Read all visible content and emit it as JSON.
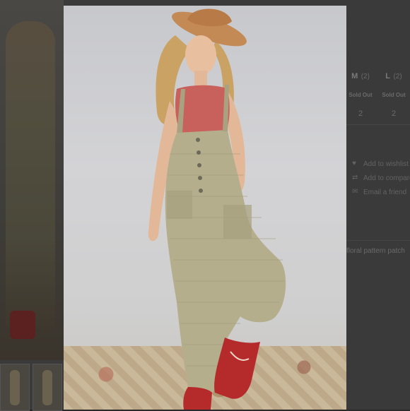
{
  "sizes": [
    {
      "label": "M",
      "count": "(2)",
      "status": "Sold Out",
      "qty": "2"
    },
    {
      "label": "L",
      "count": "(2)",
      "status": "Sold Out",
      "qty": "2"
    }
  ],
  "actions": [
    {
      "label": "Add to wishlist",
      "icon": "heart-icon"
    },
    {
      "label": "Add to compare",
      "icon": "compare-icon"
    },
    {
      "label": "Email a friend",
      "icon": "envelope-icon"
    }
  ],
  "description_snippet": "floral pattern patch",
  "colors": {
    "overalls": "#b4ae8c",
    "tank_top": "#c8605c",
    "hat": "#c48a55",
    "boots": "#b52a2a",
    "backdrop": "#cfcfd2"
  }
}
